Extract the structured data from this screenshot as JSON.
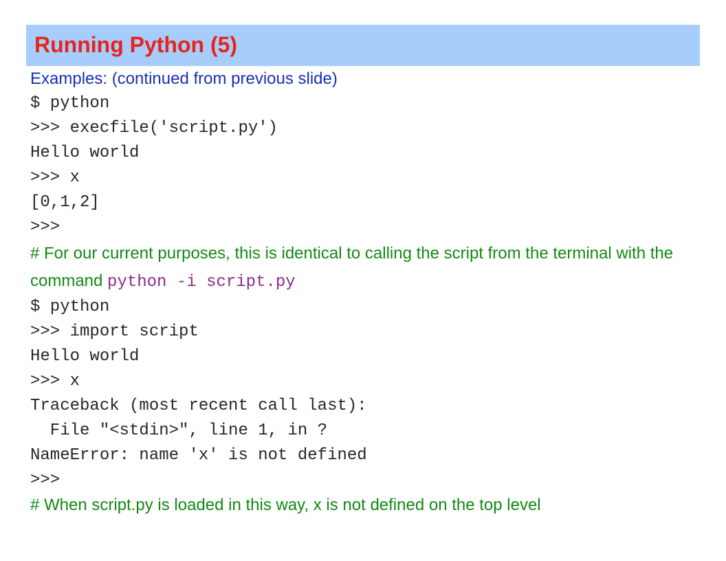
{
  "slide": {
    "title": "Running Python (5)",
    "intro": "Examples: (continued from previous slide)",
    "block1": {
      "lines": [
        "$ python",
        ">>> execfile('script.py')",
        "Hello world",
        ">>> x",
        "[0,1,2]",
        ">>>"
      ]
    },
    "comment1": {
      "text": "# For our current purposes, this is identical to calling the script from the terminal with the command ",
      "code": "python -i script.py"
    },
    "block2": {
      "lines": [
        "$ python",
        ">>> import script",
        "Hello world",
        ">>> x",
        "Traceback (most recent call last):",
        "  File \"<stdin>\", line 1, in ?",
        "NameError: name 'x' is not defined",
        ">>>"
      ]
    },
    "comment2": {
      "text": "# When script.py is loaded in this way, x is not defined on the top level"
    }
  },
  "colors": {
    "title_bar_bg": "#a6cdfb",
    "title_text": "#e8231a",
    "intro_text": "#1a2fb0",
    "code_text": "#262626",
    "comment_text": "#128a12",
    "inline_code_text": "#8a2c8a"
  }
}
